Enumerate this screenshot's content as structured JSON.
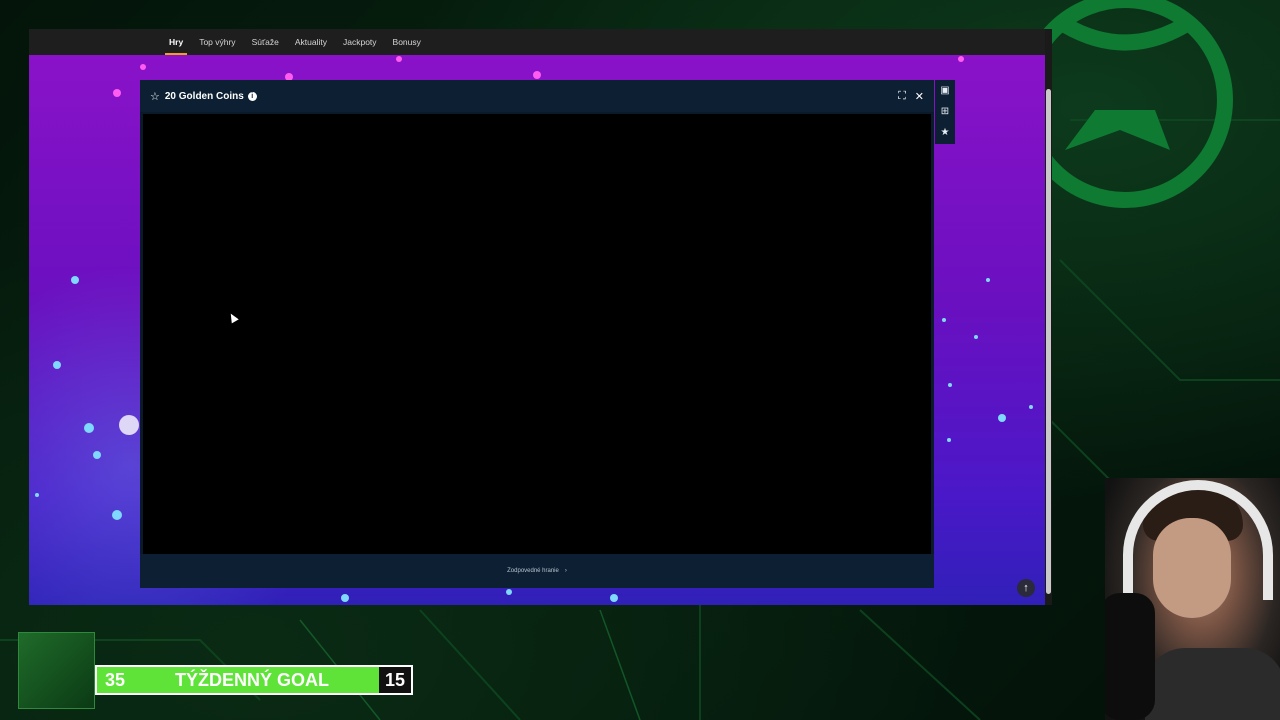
{
  "nav": {
    "items": [
      {
        "label": "Hry",
        "active": true
      },
      {
        "label": "Top výhry"
      },
      {
        "label": "Súťaže"
      },
      {
        "label": "Aktuality"
      },
      {
        "label": "Jackpoty"
      },
      {
        "label": "Bonusy"
      }
    ]
  },
  "game": {
    "title": "20 Golden Coins",
    "info_icon": "info-icon",
    "star_icon": "star-outline-icon",
    "fullscreen_icon": "fullscreen-icon",
    "close_icon": "close-icon"
  },
  "footer": {
    "link_label": "Zodpovedné hranie",
    "chevron": "›"
  },
  "side_tools": [
    "chat-icon",
    "gift-icon",
    "star-icon"
  ],
  "scroll_top_icon": "arrow-up-icon",
  "overlay": {
    "goal": {
      "left_value": "35",
      "label": "TÝŽDENNÝ GOAL",
      "right_value": "15"
    }
  },
  "colors": {
    "accent": "#f0a020",
    "page_purple": "#8a12c8",
    "goal_green": "#5fe339",
    "modal_navy": "#0c1f33"
  }
}
